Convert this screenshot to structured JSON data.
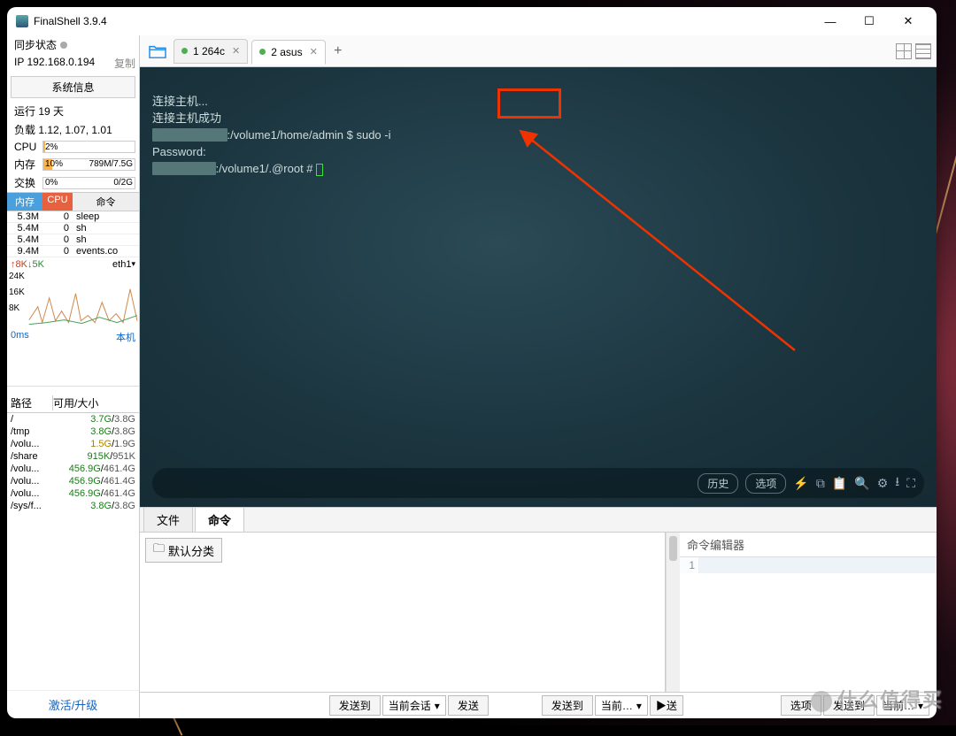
{
  "window": {
    "title": "FinalShell 3.9.4",
    "min": "—",
    "max": "☐",
    "close": "✕"
  },
  "sidebar": {
    "sync_label": "同步状态",
    "ip": "IP 192.168.0.194",
    "copy": "复制",
    "sysinfo_btn": "系统信息",
    "uptime": "运行 19 天",
    "load": "负载 1.12, 1.07, 1.01",
    "cpu_label": "CPU",
    "cpu_pct": "2%",
    "mem_label": "内存",
    "mem_pct": "10%",
    "mem_txt": "789M/7.5G",
    "swap_label": "交换",
    "swap_pct": "0%",
    "swap_txt": "0/2G",
    "proc_headers": {
      "h1": "内存",
      "h2": "CPU",
      "h3": "命令"
    },
    "procs": [
      {
        "mem": "5.3M",
        "cpu": "0",
        "cmd": "sleep"
      },
      {
        "mem": "5.4M",
        "cpu": "0",
        "cmd": "sh"
      },
      {
        "mem": "5.4M",
        "cpu": "0",
        "cmd": "sh"
      },
      {
        "mem": "9.4M",
        "cpu": "0",
        "cmd": "events.co"
      }
    ],
    "net": {
      "up": "↑8K",
      "dn": "↓5K",
      "iface": "eth1",
      "y24": "24K",
      "y16": "16K",
      "y8": "8K"
    },
    "ping": {
      "ms": "0ms",
      "host": "本机"
    },
    "fs_headers": {
      "path": "路径",
      "size": "可用/大小"
    },
    "fs": [
      {
        "path": "/",
        "size": "3.7G/3.8G"
      },
      {
        "path": "/tmp",
        "size": "3.8G/3.8G"
      },
      {
        "path": "/volu...",
        "size": "1.5G/1.9G",
        "warn": true
      },
      {
        "path": "/share",
        "size": "915K/951K"
      },
      {
        "path": "/volu...",
        "size": "456.9G/461.4G"
      },
      {
        "path": "/volu...",
        "size": "456.9G/461.4G"
      },
      {
        "path": "/volu...",
        "size": "456.9G/461.4G"
      },
      {
        "path": "/sys/f...",
        "size": "3.8G/3.8G"
      }
    ],
    "activate": "激活/升级"
  },
  "tabs": [
    {
      "label": "1 264c",
      "active": false
    },
    {
      "label": "2 asus",
      "active": true
    }
  ],
  "terminal": {
    "line1": "连接主机...",
    "line2": "连接主机成功",
    "line3a": ":/volume1/home/admin ",
    "line3b": "$ sudo -i",
    "line4": "Password:",
    "line5a": ":/volume1/.@root # ",
    "history": "历史",
    "options": "选项"
  },
  "bottom": {
    "tab_file": "文件",
    "tab_cmd": "命令",
    "default_cat": "默认分类",
    "editor_title": "命令编辑器",
    "line_no": "1",
    "send_to": "发送到",
    "current_session": "当前会话",
    "send": "发送",
    "send_to2": "发送到",
    "current2": "当前…",
    "opts": "选项",
    "send_to3": "发送到",
    "current3": "当前…"
  },
  "watermark": "什么值得买"
}
